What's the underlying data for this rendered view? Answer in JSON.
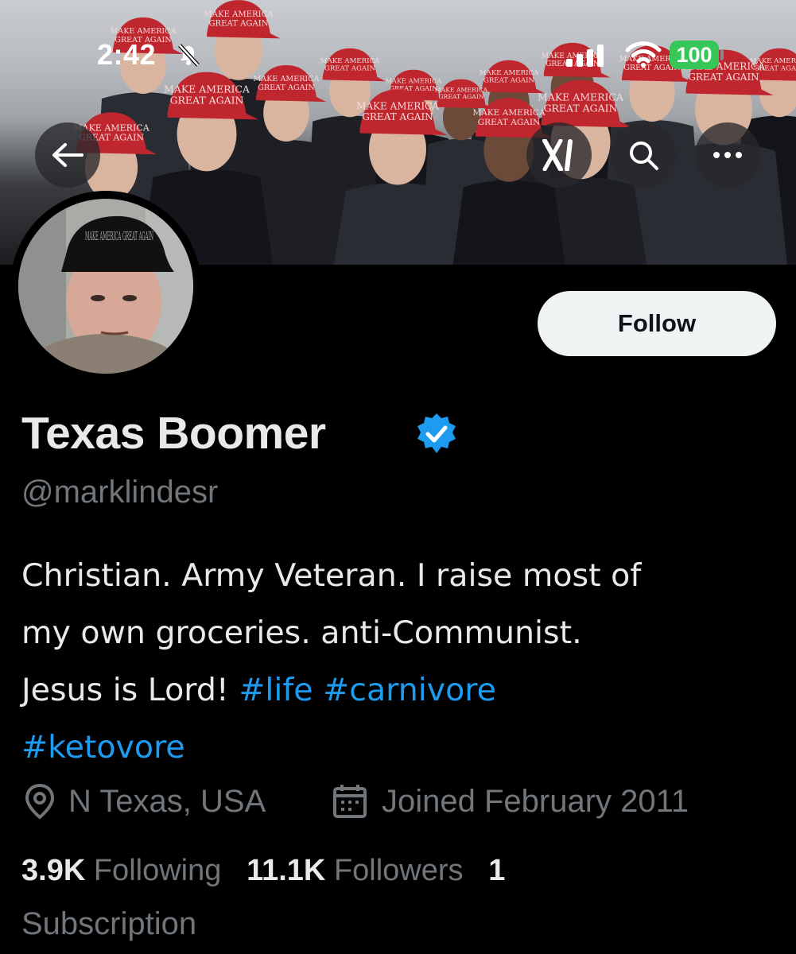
{
  "status_bar": {
    "time": "2:42",
    "battery": "100"
  },
  "banner": {
    "hat_texts": [
      "MAKE AMERICA",
      "GREAT AGAIN"
    ]
  },
  "avatar": {
    "hat_text": "MAKE AMERICA GREAT AGAIN"
  },
  "profile": {
    "name": "Texas Boomer",
    "handle": "@marklindesr",
    "follow_label": "Follow",
    "bio": {
      "line1": "Christian. Army Veteran. I raise most of",
      "line2": "my own groceries. anti-Communist.",
      "line3_text": "Jesus is Lord! ",
      "hashtags": [
        "#life",
        "#carnivore",
        "#ketovore"
      ]
    },
    "location": "N Texas, USA",
    "joined": "Joined February 2011",
    "following_count": "3.9K",
    "following_label": "Following",
    "followers_count": "11.1K",
    "followers_label": "Followers",
    "subscription_count": "1",
    "subscription_label": "Subscription"
  },
  "colors": {
    "accent": "#1d9bf0",
    "muted": "#71767b",
    "battery": "#37c759",
    "hat_red": "#c0262d"
  }
}
